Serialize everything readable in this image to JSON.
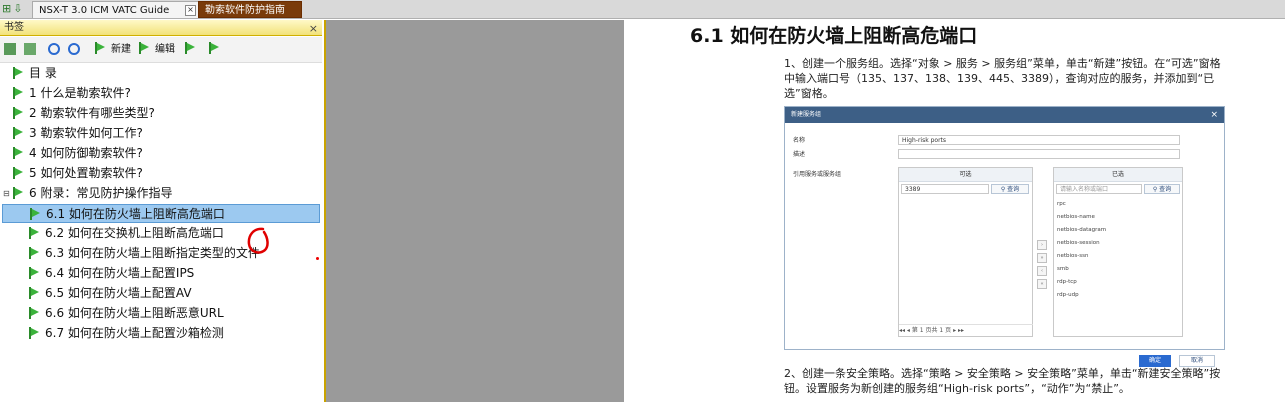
{
  "tabs": [
    {
      "label": "NSX-T 3.0 ICM VATC Guide"
    },
    {
      "label": "勒索软件防护指南"
    }
  ],
  "panel": {
    "title": "书签",
    "close": "×"
  },
  "toolbar": {
    "new_label": "新建",
    "edit_label": "编辑"
  },
  "bookmarks": [
    {
      "label": "目 录"
    },
    {
      "label": "1 什么是勒索软件?"
    },
    {
      "label": "2 勒索软件有哪些类型?"
    },
    {
      "label": "3 勒索软件如何工作?"
    },
    {
      "label": "4 如何防御勒索软件?"
    },
    {
      "label": "5 如何处置勒索软件?"
    },
    {
      "label": "6 附录：常见防护操作指导",
      "expander": "⊟"
    },
    {
      "label": "6.1 如何在防火墙上阻断高危端口",
      "selected": true
    },
    {
      "label": "6.2 如何在交换机上阻断高危端口"
    },
    {
      "label": "6.3 如何在防火墙上阻断指定类型的文件"
    },
    {
      "label": "6.4 如何在防火墙上配置IPS"
    },
    {
      "label": "6.5 如何在防火墙上配置AV"
    },
    {
      "label": "6.6 如何在防火墙上阻断恶意URL"
    },
    {
      "label": "6.7 如何在防火墙上配置沙箱检测"
    }
  ],
  "doc": {
    "heading": "6.1 如何在防火墙上阻断高危端口",
    "para1": "1、创建一个服务组。选择“对象 > 服务 > 服务组”菜单，单击“新建”按钮。在“可选”窗格中输入端口号（135、137、138、139、445、3389），查询对应的服务，并添加到“已选”窗格。",
    "para2": "2、创建一条安全策略。选择“策略 > 安全策略 > 安全策略”菜单，单击“新建安全策略”按钮。设置服务为新创建的服务组“High-risk ports”，“动作”为“禁止”。"
  },
  "dialog": {
    "title": "新建服务组",
    "name_label": "名称",
    "name_value": "High-risk ports",
    "desc_label": "描述",
    "ref_label": "引用服务或服务组",
    "available_header": "可选",
    "available_search": "3389",
    "query_label": "查询",
    "selected_header": "已选",
    "selected_placeholder": "请输入名称或端口",
    "selected_items": [
      "rpc",
      "netbios-name",
      "netbios-datagram",
      "netbios-session",
      "netbios-ssn",
      "smb",
      "rdp-tcp",
      "rdp-udp"
    ],
    "pager_text": "第 1 页共 1 页",
    "ok_label": "确定",
    "cancel_label": "取消"
  },
  "colors": {
    "accent": "#7a3b0a",
    "selection": "#9cc9f0",
    "bookmark_flag": "#3bb33b",
    "annotation": "#e00000"
  }
}
